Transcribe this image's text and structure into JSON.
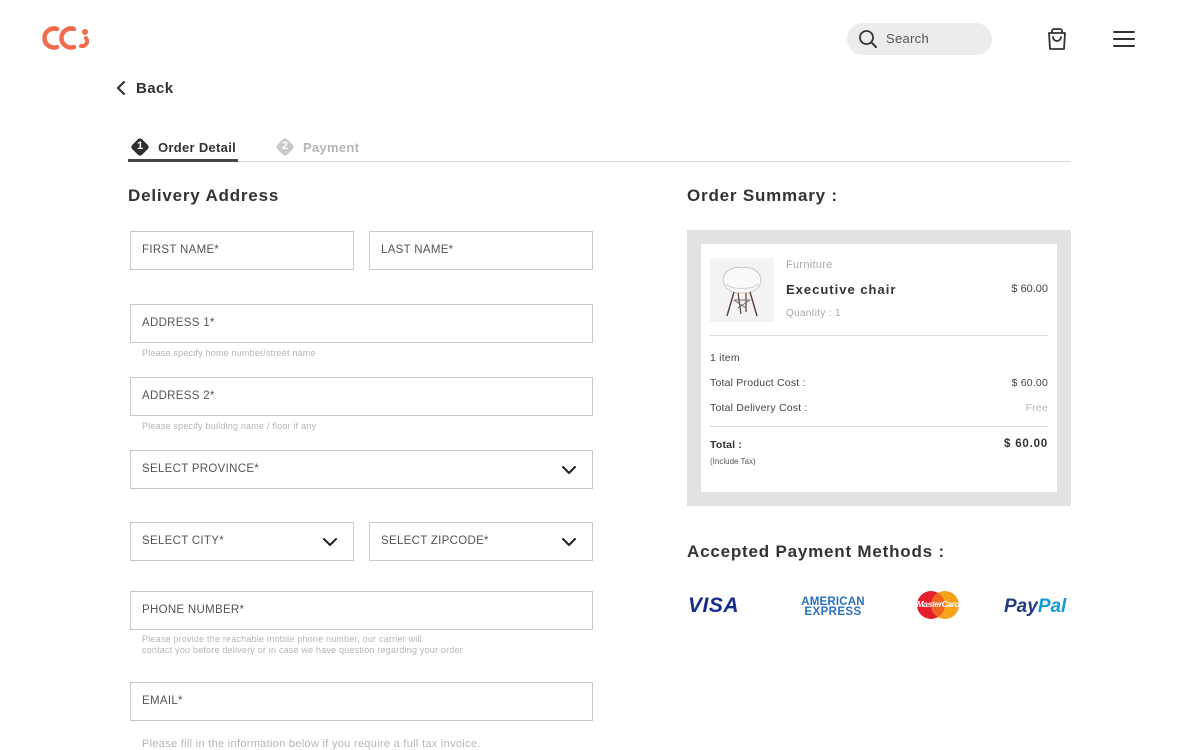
{
  "header": {
    "logo_text": "CC",
    "search_label": "Search",
    "accent_color": "#f26b4d"
  },
  "back_label": "Back",
  "steps": [
    {
      "number": "1",
      "label": "Order Detail",
      "active": true
    },
    {
      "number": "2",
      "label": "Payment",
      "active": false
    }
  ],
  "delivery": {
    "title": "Delivery Address",
    "first_name": "FIRST NAME*",
    "last_name": "LAST NAME*",
    "address1": "ADDRESS 1*",
    "address1_hint": "Please specify home number/street name",
    "address2": "ADDRESS 2*",
    "address2_hint": "Please specify building name / floor if any",
    "province": "SELECT PROVINCE*",
    "city": "SELECT CITY*",
    "zipcode": "SELECT ZIPCODE*",
    "phone": "PHONE NUMBER*",
    "phone_hint_1": "Please provide the reachable mobile phone number, our carrier will",
    "phone_hint_2": "contact you before delivery or in case we have question regarding your order",
    "email": "EMAIL*",
    "tax_note": "Please fill in the information below if you require a full tax invoice."
  },
  "summary": {
    "title": "Order Summary :",
    "product": {
      "category": "Furniture",
      "name": "Executive chair",
      "quantity": "Quantity : 1",
      "price": "$ 60.00"
    },
    "item_count": "1 item",
    "product_cost_label": "Total Product Cost :",
    "product_cost_value": "$ 60.00",
    "delivery_cost_label": "Total Delivery Cost :",
    "delivery_cost_value": "Free",
    "total_label": "Total :",
    "total_note": "(Include Tax)",
    "total_value": "$ 60.00"
  },
  "payment": {
    "title": "Accepted Payment Methods :",
    "visa": "VISA",
    "amex_1": "AMERICAN",
    "amex_2": "EXPRESS",
    "mastercard": "MasterCard",
    "paypal_1": "Pay",
    "paypal_2": "Pal"
  }
}
